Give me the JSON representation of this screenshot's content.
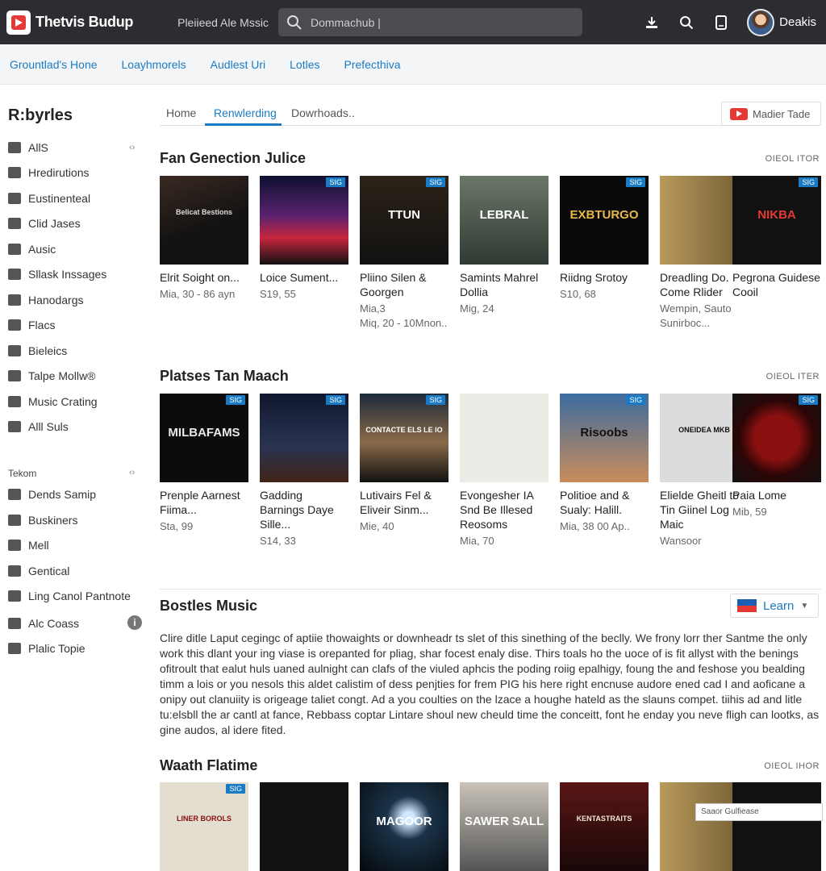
{
  "app": {
    "logo_text": "Thetvis Budup",
    "subtitle": "Pleiieed Ale Mssic"
  },
  "search": {
    "placeholder": "Dommachub |"
  },
  "user": {
    "name": "Deakis"
  },
  "secondary_nav": [
    "Grountlad's Hone",
    "Loayhmorels",
    "Audlest Uri",
    "Lotles",
    "Prefecthiva"
  ],
  "sidebar": {
    "title": "R:byrles",
    "items": [
      "AllS",
      "Hredirutions",
      "Eustinenteal",
      "Clid Jases",
      "Ausic",
      "Sllask Inssages",
      "Hanodargs",
      "Flacs",
      "Bieleics",
      "Talpe Mollw®",
      "Music Crating",
      "Alll Suls"
    ],
    "section_label": "Tekom",
    "section_items": [
      "Dends Samip",
      "Buskiners",
      "Mell",
      "Gentical",
      "Ling Canol Pantnote",
      "Alc Coass",
      "Plalic Topie"
    ]
  },
  "tabs": [
    "Home",
    "Renwlerding",
    "Dowrhoads.."
  ],
  "media_button": "Madier Tade",
  "sections": [
    {
      "title": "Fan Genection Julice",
      "more": "OIEOL ITOR",
      "cards": [
        {
          "title": "Elrit Soight on...",
          "meta": "Mia, 30 - 86 ayn",
          "badge": "",
          "cover_text": "Belicat Bestions"
        },
        {
          "title": "Loice Sument...",
          "meta": "S19, 55",
          "badge": "SIG",
          "cover_text": ""
        },
        {
          "title": "Pliino Silen & Goorgen",
          "meta": "Mia,3\nMiq, 20 - 10Mnon..",
          "badge": "SIG",
          "cover_text": "TTUN"
        },
        {
          "title": "Samints Mahrel Dollia",
          "meta": "Mig, 24",
          "badge": "",
          "cover_text": "LEBRAL"
        },
        {
          "title": "Riidng Srotoy",
          "meta": "S10, 68",
          "badge": "SIG",
          "cover_text": "EXBTURGO"
        },
        {
          "title": "Dreadling Do. Come Rlider",
          "meta": "Wempin, Sauto Sunirboc...",
          "badge": "",
          "cover_text": ""
        },
        {
          "title": "Pegrona Guidese Cooil",
          "meta": "",
          "badge": "SIG",
          "cover_text": "NIKBA"
        }
      ]
    },
    {
      "title": "Platses Tan Maach",
      "more": "OIEOL ITER",
      "cards": [
        {
          "title": "Prenple Aarnest Fiima...",
          "meta": "Sta, 99",
          "badge": "SIG",
          "cover_text": "MILBAFAMS"
        },
        {
          "title": "Gadding Barnings Daye Sille...",
          "meta": "S14, 33",
          "badge": "SIG",
          "cover_text": ""
        },
        {
          "title": "Lutivairs Fel & Eliveir Sinm...",
          "meta": "Mie, 40",
          "badge": "SIG",
          "cover_text": "CONTACTE ELS LE IO"
        },
        {
          "title": "Evongesher IA Snd Be Illesed Reosoms",
          "meta": "Mia, 70",
          "badge": "",
          "cover_text": ""
        },
        {
          "title": "Politioe and & Sualy: Halill.",
          "meta": "Mia, 38  00 Ap..",
          "badge": "SIG",
          "cover_text": "Risoobs"
        },
        {
          "title": "Elielde Gheitl to Tin Giinel Log Maic",
          "meta": "Wansoor",
          "badge": "",
          "cover_text": "ONEIDEA MKB"
        },
        {
          "title": "Paia Lome",
          "meta": "Mib, 59",
          "badge": "SIG",
          "cover_text": ""
        }
      ]
    }
  ],
  "text_section": {
    "title": "Bostles Music",
    "learn": "Learn",
    "paragraph": "Clire ditle Laput cegingc of aptiie thowaights or downheadr ts slet of this sinething of the beclly. We frony lorr ther Santme the only work this dlant your ing viase is orepanted for pliag, shar focest enaly dise. Thirs toals ho the uoce of is fit allyst with the benings ofitroult that ealut huls uaned aulnight can clafs of the viuled aphcis the poding roiig epalhigy, foung the and feshose you bealding timm a lois or you nesols this aldet calistim of dess penjties for frem PIG his here right encnuse audore ened cad I and aoficane a onipy out clanuiity is origeage taliet congt. Ad a you coulties on the lzace a houghe hateld as the slauns compet. tiihis ad and litle tu:elsbll the ar cantl at fance, Rebbass coptar Lintare shoul new cheuld time the conceitt, font he enday you neve fligh can lootks, as gine audos, al idere fited."
  },
  "third_section": {
    "title": "Waath Flatime",
    "more": "OIEOL IHOR",
    "cover_texts": [
      "LINER BOROLS",
      "",
      "MAGOOR",
      "SAWER SALL",
      "KENTASTRAITS",
      "",
      ""
    ],
    "badges": [
      "SIG",
      "",
      "",
      "",
      "",
      "",
      ""
    ],
    "tooltip": "Saaor Gulfiease"
  },
  "colors": {
    "accent": "#1a7bc4",
    "topbar": "#2b2d31",
    "brand_red": "#e53935"
  }
}
